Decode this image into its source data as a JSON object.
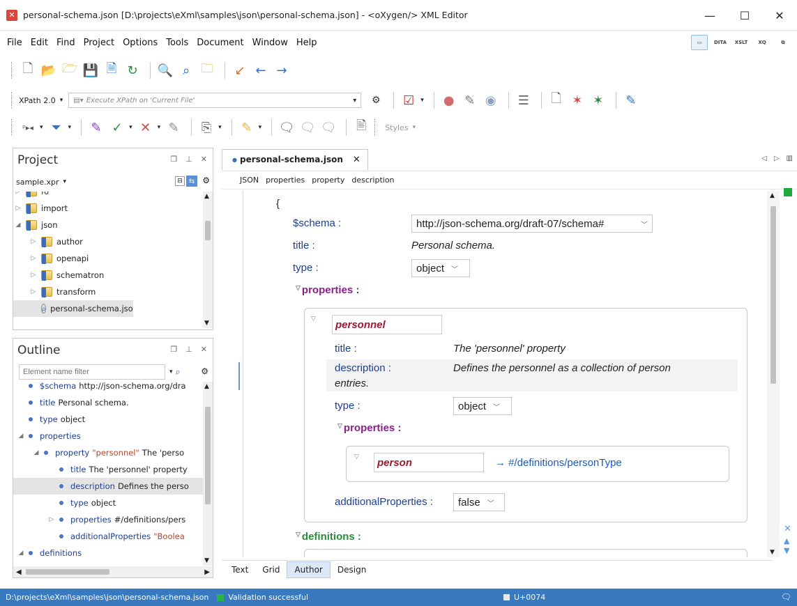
{
  "window": {
    "title": "personal-schema.json [D:\\projects\\eXml\\samples\\json\\personal-schema.json] - <oXygen/> XML Editor",
    "minimize": "—",
    "maximize": "☐",
    "close": "✕"
  },
  "menu": [
    "File",
    "Edit",
    "Find",
    "Project",
    "Options",
    "Tools",
    "Document",
    "Window",
    "Help"
  ],
  "perspectives": [
    "",
    "DITA",
    "XSLT",
    "XQ",
    ""
  ],
  "xpath": {
    "version": "XPath 2.0",
    "placeholder": "Execute XPath on 'Current File'"
  },
  "toolbar": {
    "styles_label": "Styles"
  },
  "project": {
    "title": "Project",
    "file": "sample.xpr",
    "items": [
      {
        "label": "fo",
        "level": 0,
        "type": "folder",
        "expanded": false
      },
      {
        "label": "import",
        "level": 0,
        "type": "folder",
        "expanded": false
      },
      {
        "label": "json",
        "level": 0,
        "type": "folder",
        "expanded": true
      },
      {
        "label": "author",
        "level": 1,
        "type": "folder",
        "expanded": false
      },
      {
        "label": "openapi",
        "level": 1,
        "type": "folder",
        "expanded": false
      },
      {
        "label": "schematron",
        "level": 1,
        "type": "folder",
        "expanded": false
      },
      {
        "label": "transform",
        "level": 1,
        "type": "folder",
        "expanded": false
      },
      {
        "label": "personal-schema.json",
        "level": 1,
        "type": "file",
        "selected": true
      }
    ]
  },
  "outline": {
    "title": "Outline",
    "filter_placeholder": "Element name filter",
    "items": [
      {
        "name": "$schema",
        "value": "http://json-schema.org/dra",
        "level": 0,
        "arrow": ""
      },
      {
        "name": "title",
        "value": "Personal schema.",
        "level": 0,
        "arrow": ""
      },
      {
        "name": "type",
        "value": "object",
        "level": 0,
        "arrow": ""
      },
      {
        "name": "properties",
        "value": "",
        "level": 0,
        "arrow": "◢"
      },
      {
        "name": "property",
        "value": "\"personnel\"",
        "extra": "The 'perso",
        "level": 1,
        "arrow": "◢"
      },
      {
        "name": "title",
        "value": "The 'personnel' property",
        "level": 2,
        "arrow": ""
      },
      {
        "name": "description",
        "value": "Defines the perso",
        "level": 2,
        "arrow": "",
        "selected": true
      },
      {
        "name": "type",
        "value": "object",
        "level": 2,
        "arrow": ""
      },
      {
        "name": "properties",
        "value": "#/definitions/pers",
        "level": 2,
        "arrow": "▷"
      },
      {
        "name": "additionalProperties",
        "value": "\"Boolea",
        "level": 2,
        "arrow": "",
        "orange": true
      },
      {
        "name": "definitions",
        "value": "",
        "level": 0,
        "arrow": "◢"
      }
    ]
  },
  "editor": {
    "tab": "personal-schema.json",
    "breadcrumb": [
      "JSON",
      "properties",
      "property",
      "description"
    ],
    "open_brace": "{",
    "schema_key": "$schema :",
    "schema_value": "http://json-schema.org/draft-07/schema#",
    "title_key": "title :",
    "title_value": "Personal schema.",
    "type_key": "type :",
    "type_value": "object",
    "properties_label": "properties :",
    "personnel": {
      "name": "personnel",
      "title_key": "title :",
      "title_value": "The 'personnel' property",
      "description_key": "description :",
      "description_value": "Defines the personnel as a collection of person",
      "description_cont": "entries.",
      "type_key": "type :",
      "type_value": "object",
      "properties_label": "properties :",
      "person_name": "person",
      "person_ref": "→ #/definitions/personType",
      "additional_key": "additionalProperties :",
      "additional_value": "false"
    },
    "definitions_label": "definitions :",
    "modes": [
      "Text",
      "Grid",
      "Author",
      "Design"
    ],
    "active_mode": "Author"
  },
  "status": {
    "path": "D:\\projects\\eXml\\samples\\json\\personal-schema.json",
    "validation": "Validation successful",
    "unicode": "U+0074"
  },
  "colors": {
    "accent": "#3979c0",
    "success": "#22a93d",
    "property": "#8a1f8a",
    "name": "#9a1b2e"
  }
}
